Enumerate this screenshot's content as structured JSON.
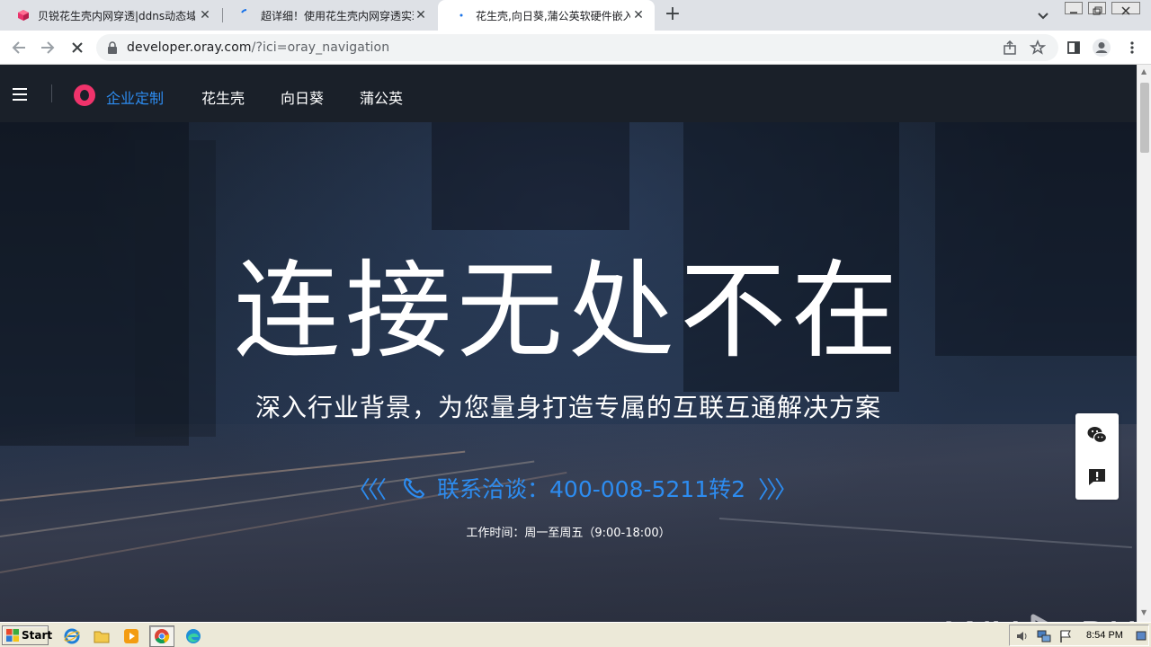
{
  "browser": {
    "tabs": [
      {
        "title": "贝锐花生壳内网穿透|ddns动态域名",
        "favicon": "oray-cube-icon",
        "active": false
      },
      {
        "title": "超详细！使用花生壳内网穿透实现外",
        "favicon": "loading-spinner-icon",
        "active": false
      },
      {
        "title": "花生壳,向日葵,蒲公英软硬件嵌入,DI",
        "favicon": "loading-dot-icon",
        "active": true
      }
    ],
    "new_tab_label": "+",
    "close_glyph": "✕",
    "address": {
      "host": "developer.oray.com",
      "path": "/?ici=oray_navigation"
    }
  },
  "site": {
    "nav": {
      "items": [
        {
          "label": "企业定制",
          "active": true
        },
        {
          "label": "花生壳",
          "active": false
        },
        {
          "label": "向日葵",
          "active": false
        },
        {
          "label": "蒲公英",
          "active": false
        }
      ],
      "accent_color": "#2d8cf0",
      "logo_color": "#f0336b"
    },
    "hero": {
      "title": "连接无处不在",
      "subtitle": "深入行业背景，为您量身打造专属的互联互通解决方案",
      "contact_left_chevrons": "〈〈〈",
      "contact_text": "联系洽谈：400-008-5211转2",
      "contact_right_chevrons": "〉〉〉",
      "hours": "工作时间：周一至周五（9:00-18:00）"
    },
    "side_buttons": [
      "wechat-icon",
      "feedback-icon"
    ]
  },
  "watermark": {
    "left": "ANY",
    "right": "RUN"
  },
  "taskbar": {
    "start_label": "Start",
    "clock": "8:54 PM",
    "quicklaunch": [
      "ie-icon",
      "folder-icon",
      "media-player-icon",
      "chrome-icon",
      "edge-icon"
    ]
  }
}
